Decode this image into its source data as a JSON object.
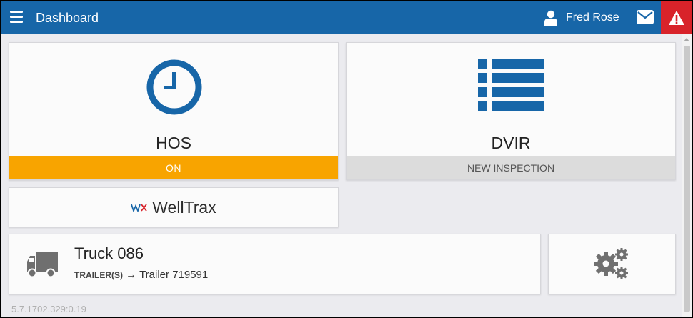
{
  "header": {
    "title": "Dashboard",
    "user_name": "Fred Rose",
    "icons": {
      "menu": "hamburger-menu-icon",
      "user": "user-icon",
      "mail": "envelope-icon",
      "alert": "warning-triangle-icon"
    },
    "colors": {
      "bar": "#1766a8",
      "alert": "#d8232a"
    }
  },
  "tiles": {
    "hos": {
      "label": "HOS",
      "status": "ON",
      "icon": "clock-icon",
      "status_color": "#f8a400"
    },
    "dvir": {
      "label": "DVIR",
      "status": "NEW INSPECTION",
      "icon": "list-icon"
    },
    "welltrax": {
      "label": "WellTrax",
      "logo": "wx-logo-icon"
    }
  },
  "vehicle": {
    "truck": "Truck 086",
    "trailer_key": "TRAILER(S)",
    "arrow": "→",
    "trailer_value": "Trailer 719591",
    "icon": "truck-icon"
  },
  "settings": {
    "icon": "gears-icon"
  },
  "footer": {
    "version": "5.7.1702.329:0.19"
  }
}
